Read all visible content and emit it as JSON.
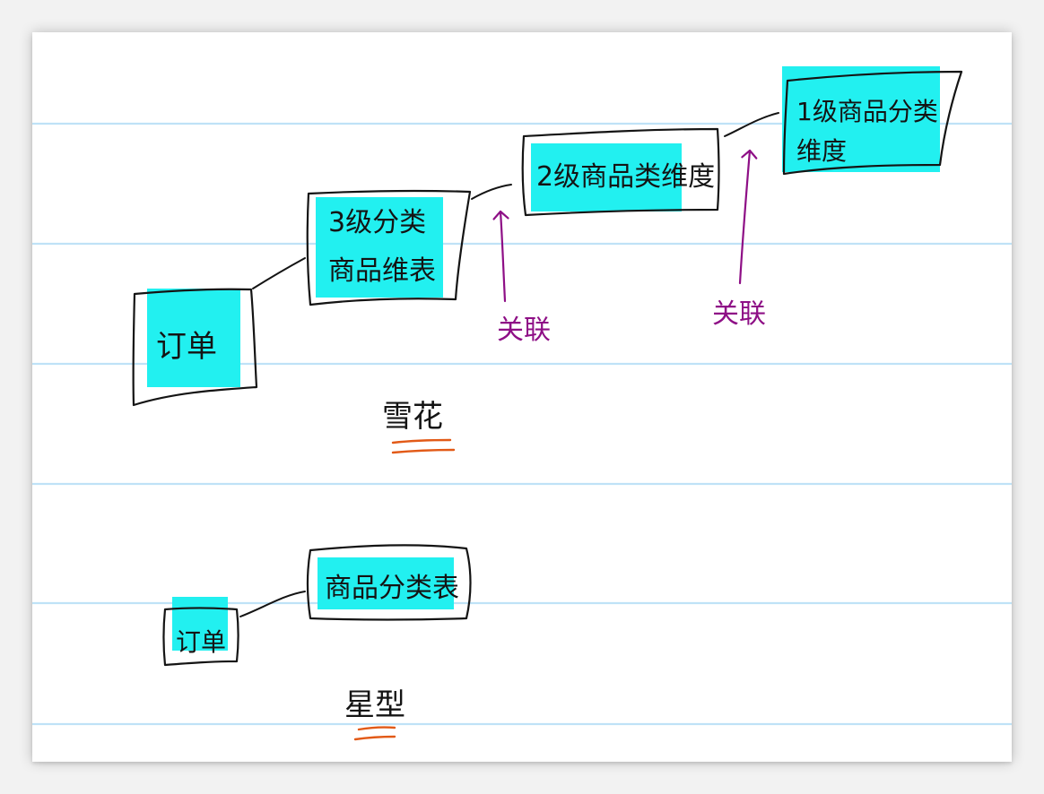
{
  "colors": {
    "rule_line": "#bfe2f7",
    "box_ink": "#141414",
    "highlight": "#22f0f0",
    "annotation_purple": "#8e0f86",
    "underline_orange": "#e25a17"
  },
  "snowflake": {
    "fact_table": {
      "label": "订单"
    },
    "level3_dim": {
      "line1": "3级分类",
      "line2": "商品维表"
    },
    "level2_dim": {
      "label": "2级商品类维度"
    },
    "level1_dim": {
      "line1": "1级商品分类",
      "line2": "维度"
    },
    "relation_arrow_1": {
      "label": "关联"
    },
    "relation_arrow_2": {
      "label": "关联"
    },
    "model_label": "雪花"
  },
  "star": {
    "fact_table": {
      "label": "订单"
    },
    "category_dim": {
      "label": "商品分类表"
    },
    "model_label": "星型"
  }
}
